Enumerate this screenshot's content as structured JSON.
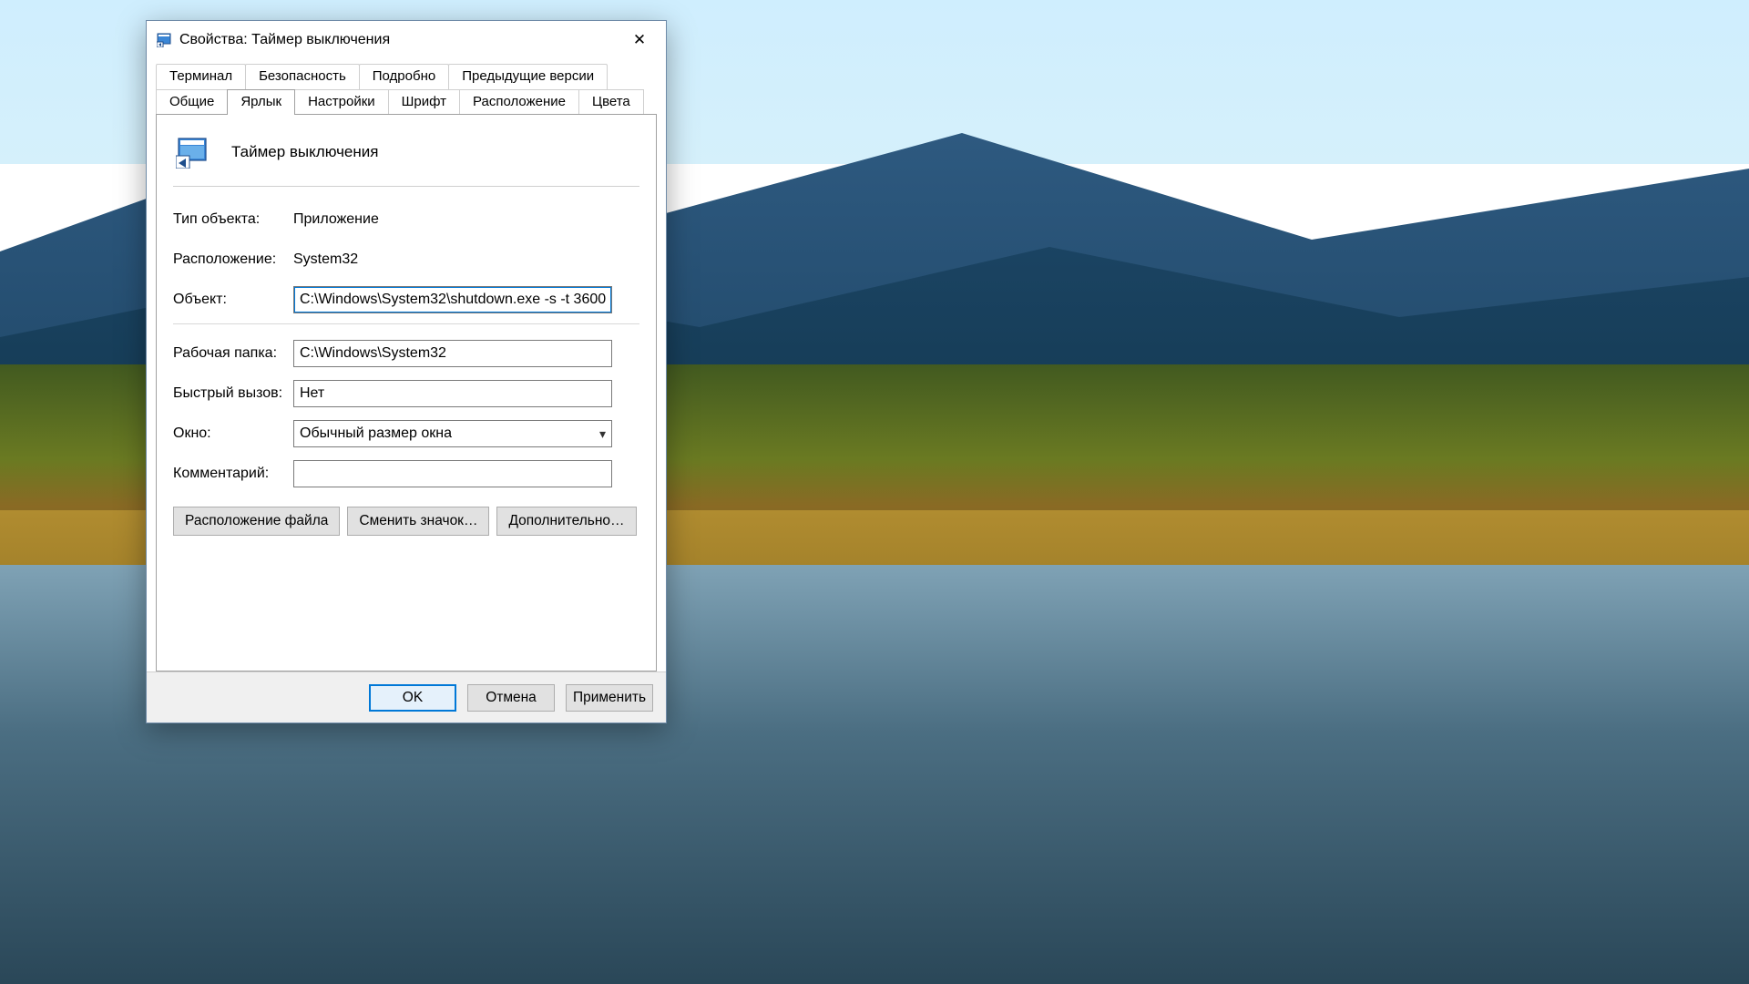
{
  "window": {
    "title": "Свойства: Таймер выключения",
    "close_glyph": "✕"
  },
  "tabs": {
    "row1": [
      "Терминал",
      "Безопасность",
      "Подробно",
      "Предыдущие версии"
    ],
    "row2": [
      "Общие",
      "Ярлык",
      "Настройки",
      "Шрифт",
      "Расположение",
      "Цвета"
    ],
    "active": "Ярлык"
  },
  "header": {
    "name": "Таймер выключения"
  },
  "fields": {
    "object_type_label": "Тип объекта:",
    "object_type_value": "Приложение",
    "location_label": "Расположение:",
    "location_value": "System32",
    "target_label": "Объект:",
    "target_value": "C:\\Windows\\System32\\shutdown.exe -s -t 3600",
    "start_in_label": "Рабочая папка:",
    "start_in_value": "C:\\Windows\\System32",
    "hotkey_label": "Быстрый вызов:",
    "hotkey_value": "Нет",
    "run_label": "Окно:",
    "run_value": "Обычный размер окна",
    "comment_label": "Комментарий:",
    "comment_value": ""
  },
  "panel_buttons": {
    "open_location": "Расположение файла",
    "change_icon": "Сменить значок…",
    "advanced": "Дополнительно…"
  },
  "footer": {
    "ok": "OK",
    "cancel": "Отмена",
    "apply": "Применить"
  },
  "icons": {
    "app_small": "shortcut-properties-icon",
    "app_large": "shortcut-large-icon",
    "chevron": "▾"
  }
}
